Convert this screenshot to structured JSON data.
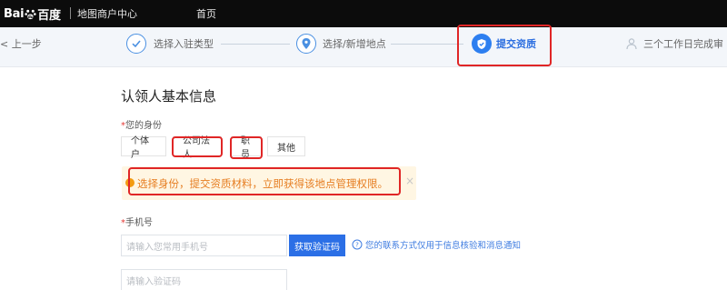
{
  "header": {
    "logo": {
      "left": "Bai",
      "right": "百度"
    },
    "product": "地图商户中心",
    "nav_home": "首页"
  },
  "steps": {
    "back": "< 上一步",
    "items": [
      {
        "label": "选择入驻类型",
        "icon": "check-icon",
        "state": "done"
      },
      {
        "label": "选择/新增地点",
        "icon": "location-pin-icon",
        "state": "done"
      },
      {
        "label": "提交资质",
        "icon": "shield-icon",
        "state": "active"
      },
      {
        "label": "三个工作日完成审",
        "icon": "user-icon",
        "state": "pending"
      }
    ]
  },
  "form": {
    "heading": "认领人基本信息",
    "identity_label": "您的身份",
    "identity_options": [
      "个体户",
      "公司法人",
      "职员",
      "其他"
    ],
    "notice": "选择身份，提交资质材料，立即获得该地点管理权限。",
    "phone_label": "手机号",
    "phone_placeholder": "请输入您常用手机号",
    "get_code_button": "获取验证码",
    "phone_hint": "您的联系方式仅用于信息核验和消息通知",
    "code_placeholder": "请输入验证码"
  },
  "colors": {
    "accent": "#2b6fe6",
    "highlight_box": "#e02626",
    "notice_text": "#e67e22",
    "notice_bg": "#fff6e3",
    "header_bg": "#0c0c0c"
  }
}
